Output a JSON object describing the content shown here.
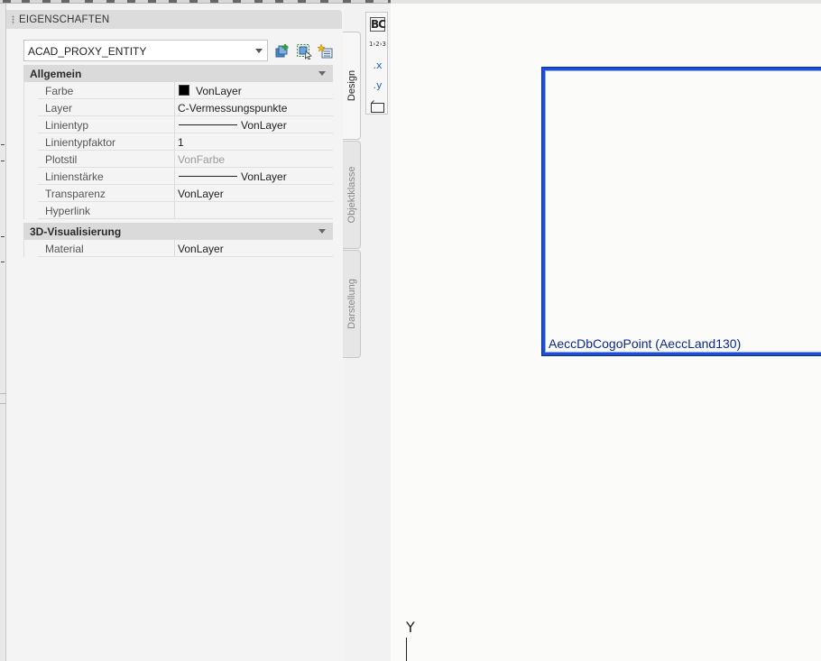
{
  "panel": {
    "title": "EIGENSCHAFTEN",
    "selector_value": "ACAD_PROXY_ENTITY",
    "toolbar_icons": [
      "quick-select-icon",
      "select-objects-icon",
      "toggle-pickadd-icon"
    ]
  },
  "sections": [
    {
      "title": "Allgemein",
      "rows": [
        {
          "label": "Farbe",
          "value": "VonLayer"
        },
        {
          "label": "Layer",
          "value": "C-Vermessungspunkte"
        },
        {
          "label": "Linientyp",
          "value": "VonLayer"
        },
        {
          "label": "Linientypfaktor",
          "value": "1"
        },
        {
          "label": "Plotstil",
          "value": "VonFarbe"
        },
        {
          "label": "Linienstärke",
          "value": "VonLayer"
        },
        {
          "label": "Transparenz",
          "value": "VonLayer"
        },
        {
          "label": "Hyperlink",
          "value": ""
        }
      ]
    },
    {
      "title": "3D-Visualisierung",
      "rows": [
        {
          "label": "Material",
          "value": "VonLayer"
        }
      ]
    }
  ],
  "tabs": [
    {
      "label": "Design",
      "active": true
    },
    {
      "label": "Objektklasse",
      "active": false
    },
    {
      "label": "Darstellung",
      "active": false
    }
  ],
  "tools": {
    "bc_label": "BC",
    "numbering_label": "1›2›3",
    "x_label": ".x",
    "y_label": ".y"
  },
  "canvas": {
    "entity_label": "AeccDbCogoPoint (AeccLand130)",
    "ucs_axis_label": "Y",
    "background_color": "#fbfbf9",
    "highlight_color": "#1c4fd6"
  }
}
